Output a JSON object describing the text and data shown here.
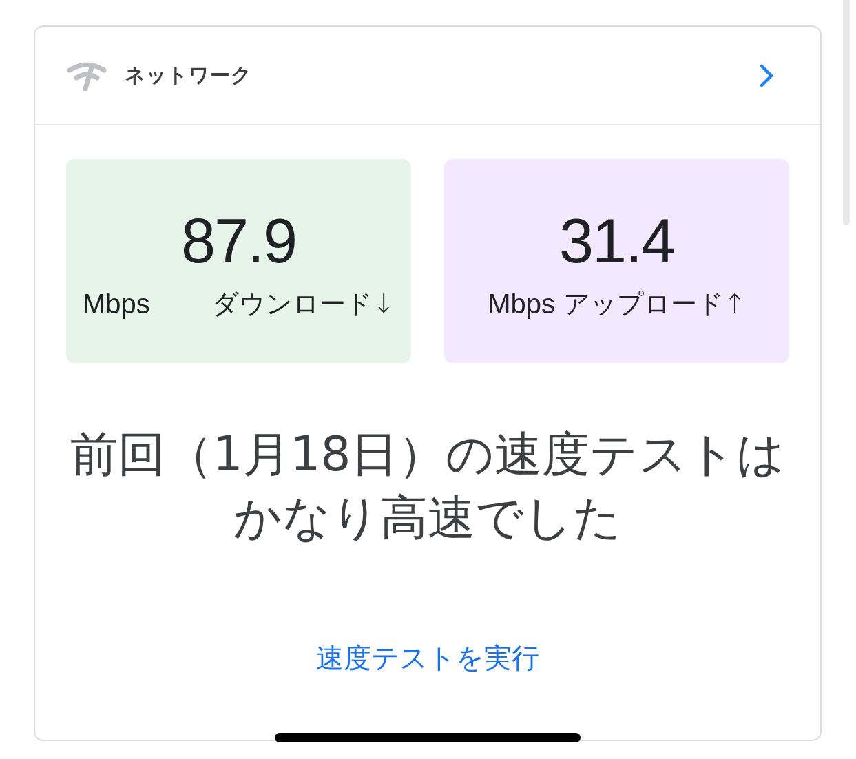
{
  "card": {
    "header": {
      "title": "ネットワーク"
    },
    "speeds": [
      {
        "kind": "download",
        "value": "87.9",
        "unit": "Mbps",
        "label": "ダウンロード↓"
      },
      {
        "kind": "upload",
        "value": "31.4",
        "unit": "Mbps",
        "label": "アップロード↑"
      }
    ],
    "message": "前回（1月18日）の速度テストはかなり高速でした",
    "action": "速度テストを実行"
  }
}
